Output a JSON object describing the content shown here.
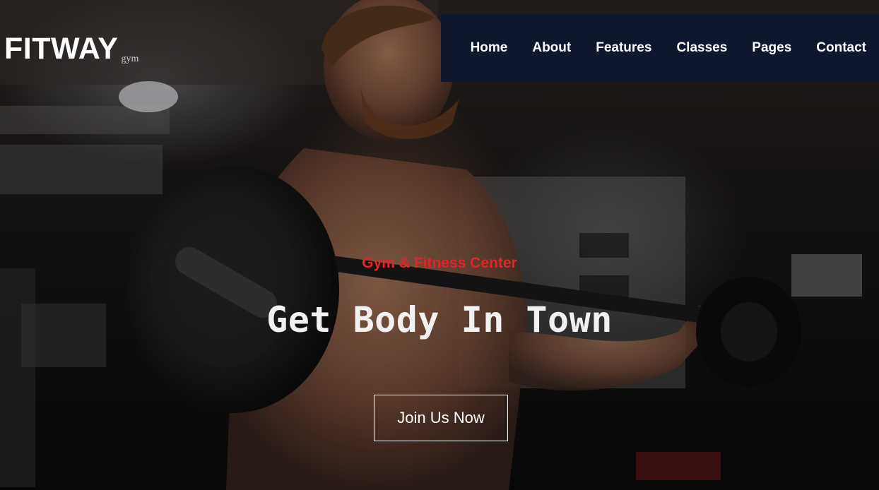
{
  "brand": {
    "name": "FITWAY",
    "tagline": "gym"
  },
  "nav": {
    "items": [
      {
        "label": "Home"
      },
      {
        "label": "About"
      },
      {
        "label": "Features"
      },
      {
        "label": "Classes"
      },
      {
        "label": "Pages"
      },
      {
        "label": "Contact"
      }
    ]
  },
  "hero": {
    "eyebrow": "Gym & Fitness Center",
    "headline": "Get Body In Town",
    "cta_label": "Join Us Now"
  },
  "colors": {
    "nav_background": "#0f172d",
    "accent": "#e02626",
    "text": "#ffffff"
  }
}
